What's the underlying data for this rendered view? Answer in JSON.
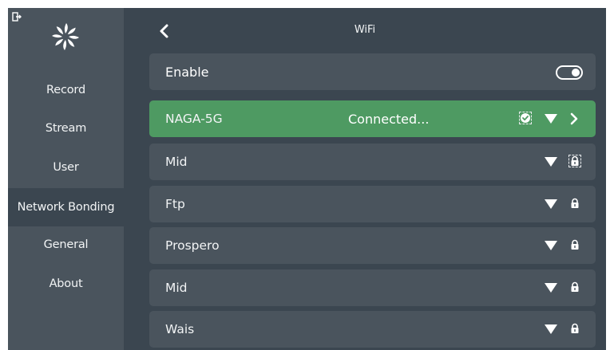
{
  "sidebar": {
    "items": [
      {
        "label": "Record"
      },
      {
        "label": "Stream"
      },
      {
        "label": "User"
      },
      {
        "label": "Network Bonding",
        "active": true
      },
      {
        "label": "General"
      },
      {
        "label": "About"
      }
    ]
  },
  "header": {
    "title": "WiFi",
    "back_icon": "chevron-left-icon"
  },
  "enable_row": {
    "label": "Enable",
    "toggle_on": true
  },
  "networks": [
    {
      "name": "NAGA-5G",
      "status": "Connected...",
      "connected": true,
      "locked": false
    },
    {
      "name": "Mid",
      "locked": true
    },
    {
      "name": "Ftp",
      "locked": true
    },
    {
      "name": "Prospero",
      "locked": true
    },
    {
      "name": "Mid",
      "locked": true
    },
    {
      "name": "Wais",
      "locked": true
    }
  ],
  "colors": {
    "background": "#3b4650",
    "sidebar": "#4a545d",
    "row": "#4a545d",
    "connected_row": "#4e9a62",
    "text": "#f2f4f5"
  }
}
